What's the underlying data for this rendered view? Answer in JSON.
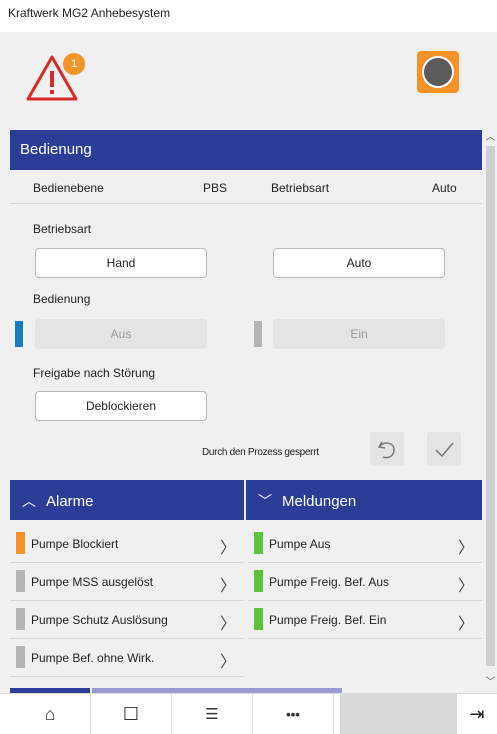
{
  "window": {
    "title": "Kraftwerk MG2 Anhebesystem"
  },
  "topbar": {
    "alarm_count": "1",
    "alarm_icon": "warning-triangle-icon",
    "pump_icon": "pump-icon"
  },
  "panel": {
    "title": "Bedienung",
    "info": {
      "bedienebene_label": "Bedienebene",
      "bedienebene_value": "PBS",
      "betriebsart_label": "Betriebsart",
      "betriebsart_value": "Auto"
    },
    "betriebsart": {
      "label": "Betriebsart",
      "btn_hand": "Hand",
      "btn_auto": "Auto"
    },
    "bedienung": {
      "label": "Bedienung",
      "btn_aus": "Aus",
      "btn_ein": "Ein"
    },
    "freigabe": {
      "label": "Freigabe nach Störung",
      "btn_deblock": "Deblockieren"
    },
    "status_text": "Durch den Prozess gesperrt"
  },
  "alarme": {
    "title": "Alarme",
    "items": [
      {
        "label": "Pumpe Blockiert",
        "color": "#f5922a"
      },
      {
        "label": "Pumpe MSS ausgelöst",
        "color": "#b4b4b4"
      },
      {
        "label": "Pumpe Schutz Auslösung",
        "color": "#b4b4b4"
      },
      {
        "label": "Pumpe Bef. ohne Wirk.",
        "color": "#b4b4b4"
      }
    ]
  },
  "meldungen": {
    "title": "Meldungen",
    "items": [
      {
        "label": "Pumpe Aus",
        "color": "#5cc23c"
      },
      {
        "label": "Pumpe Freig. Bef. Aus",
        "color": "#5cc23c"
      },
      {
        "label": "Pumpe Freig. Bef. Ein",
        "color": "#5cc23c"
      }
    ]
  },
  "colors": {
    "header": "#2b3d97",
    "accent_blue": "#1a7bc4",
    "orange": "#f5922a",
    "green": "#5cc23c"
  },
  "nav": {
    "home": "⌂",
    "page": "☐",
    "menu": "☰",
    "more": "•••",
    "exit": "⇥"
  }
}
